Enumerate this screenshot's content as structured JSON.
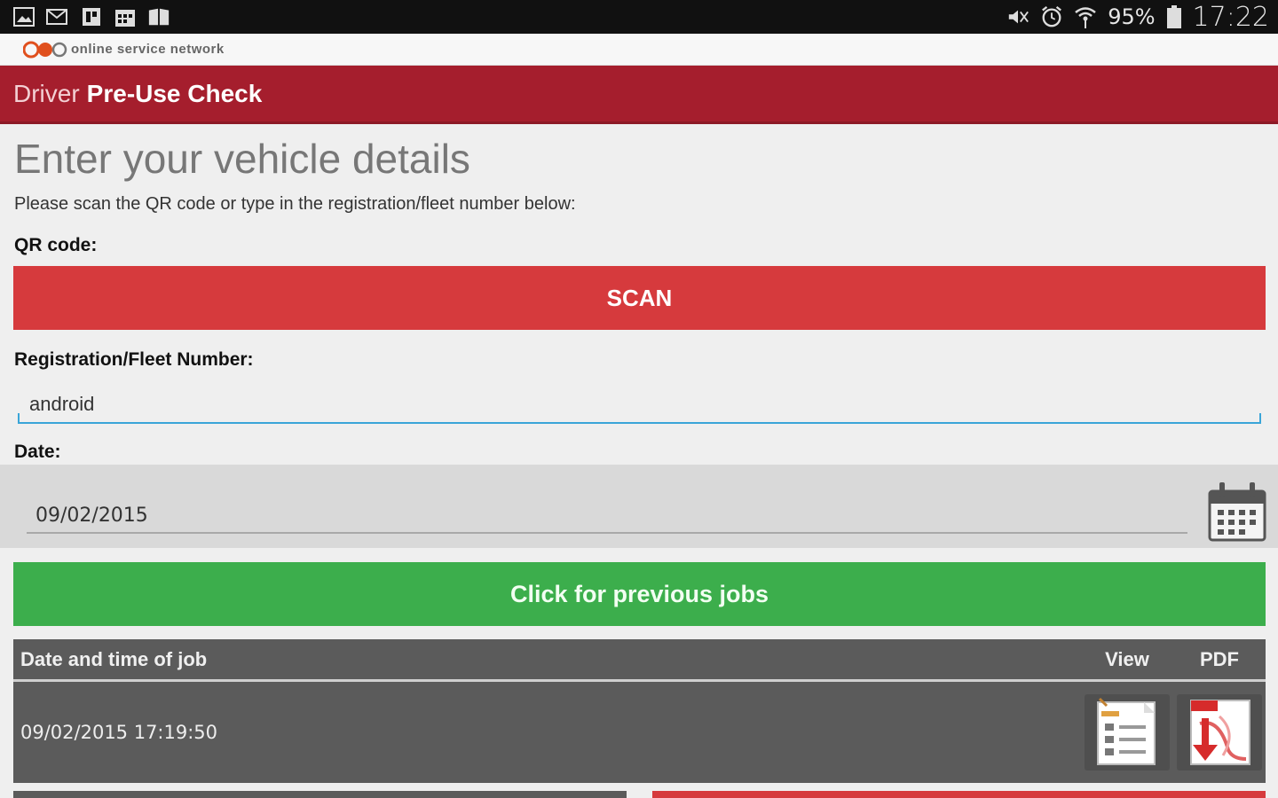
{
  "status_bar": {
    "battery": "95%",
    "time": "17:22",
    "left_icons": [
      "image-icon",
      "mail-icon",
      "app-icon",
      "calendar-icon",
      "book-icon"
    ],
    "right_icons": [
      "mute-icon",
      "alarm-icon",
      "wifi-icon",
      "battery-icon"
    ]
  },
  "brand": {
    "text": "online service network"
  },
  "header": {
    "title_light": "Driver",
    "title_bold": "Pre-Use Check",
    "color": "#a51e2d"
  },
  "main": {
    "title": "Enter your vehicle details",
    "subtitle": "Please scan the QR code or type in the registration/fleet number below:",
    "qr_label": "QR code:",
    "scan_label": "SCAN",
    "reg_label": "Registration/Fleet Number:",
    "reg_value": "android",
    "date_label": "Date:",
    "date_value": "09/02/2015",
    "previous_jobs_label": "Click for previous jobs"
  },
  "jobs_table": {
    "headers": {
      "date": "Date and time of job",
      "view": "View",
      "pdf": "PDF"
    },
    "rows": [
      {
        "datetime": "09/02/2015 17:19:50"
      }
    ]
  },
  "colors": {
    "scan_button": "#d63a3d",
    "previous_button": "#3cae4c",
    "table_bg": "#5b5b5b",
    "input_focus": "#3aa5d8"
  }
}
